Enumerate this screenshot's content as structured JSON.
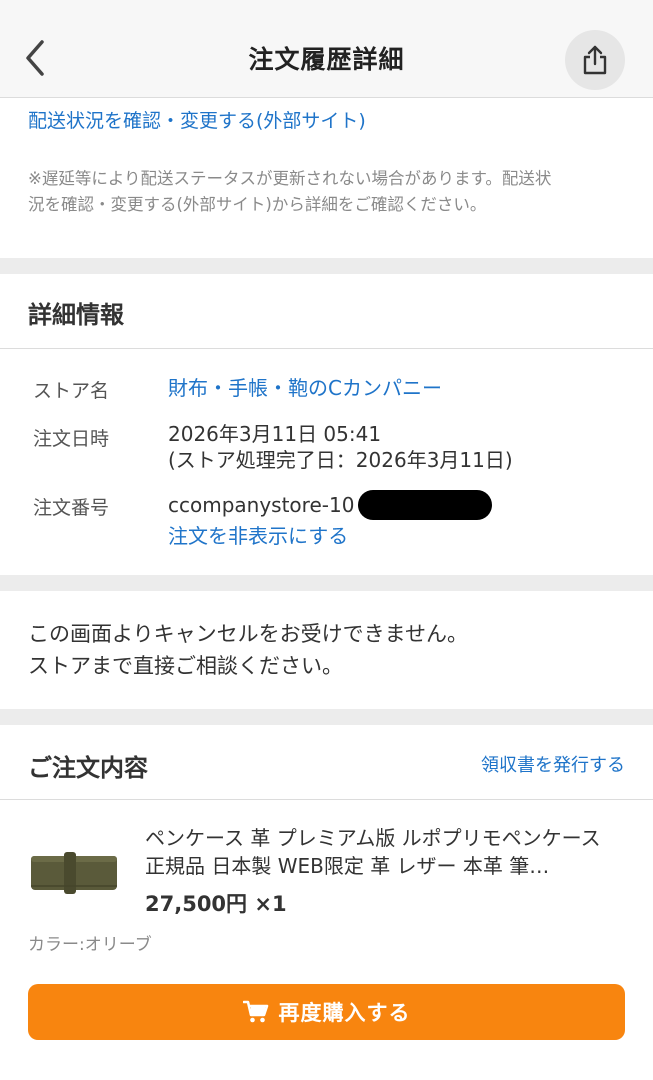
{
  "header": {
    "title": "注文履歴詳細",
    "back_icon": "chevron-left-icon",
    "share_icon": "share-icon"
  },
  "shipping": {
    "link_label": "配送状況を確認・変更する(外部サイト)",
    "note_line1": "※遅延等により配送ステータスが更新されない場合があります。配送状",
    "note_line2": "況を確認・変更する(外部サイト)から詳細をご確認ください。"
  },
  "details": {
    "title": "詳細情報",
    "store_label": "ストア名",
    "store_value": "財布・手帳・鞄のCカンパニー",
    "date_label": "注文日時",
    "date_value": "2026年3月11日 05:41",
    "date_sub": "(ストア処理完了日：2026年3月11日)",
    "order_label": "注文番号",
    "order_value": "ccompanystore-10",
    "hide_link": "注文を非表示にする"
  },
  "notice": {
    "line1": "この画面よりキャンセルをお受けできません。",
    "line2": "ストアまで直接ご相談ください。"
  },
  "order_contents": {
    "title": "ご注文内容",
    "receipt_link": "領収書を発行する",
    "product": {
      "name": "ペンケース 革 プレミアム版 ルポプリモペンケース 正規品 日本製 WEB限定 革 レザー 本革 筆…",
      "price": "27,500円 ×1",
      "option": "カラー:オリーブ"
    },
    "rebuy_label": "再度購入する",
    "rebuy_icon": "cart-icon"
  },
  "colors": {
    "link": "#1f74c9",
    "accent_orange": "#f8850f",
    "section_gap": "#ececec",
    "product_olive": "#5a5a3a"
  }
}
